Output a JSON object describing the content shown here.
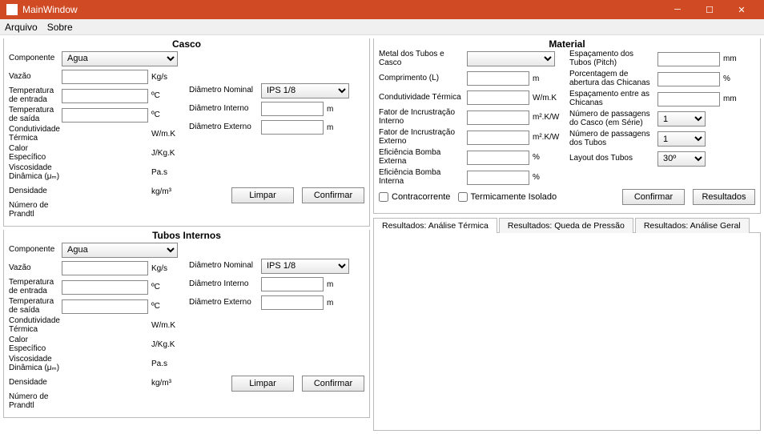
{
  "window": {
    "title": "MainWindow"
  },
  "menu": {
    "file": "Arquivo",
    "about": "Sobre"
  },
  "casco": {
    "title": "Casco",
    "componente_lbl": "Componente",
    "componente_val": "Agua",
    "vazao_lbl": "Vazão",
    "vazao_unit": "Kg/s",
    "temp_in_lbl": "Temperatura de entrada",
    "temp_unit": "ºC",
    "temp_out_lbl": "Temperatura de saída",
    "cond_lbl": "Condutividade Térmica",
    "cond_unit": "W/m.K",
    "calor_lbl": "Calor Específico",
    "calor_unit": "J/Kg.K",
    "visc_lbl": "Viscosidade Dinâmica (μₘ)",
    "visc_unit": "Pa.s",
    "dens_lbl": "Densidade",
    "dens_unit": "kg/m³",
    "prandtl_lbl": "Número de Prandtl",
    "dnom_lbl": "Diâmetro Nominal",
    "dnom_val": "IPS 1/8",
    "dint_lbl": "Diâmetro Interno",
    "dext_lbl": "Diâmetro Externo",
    "m_unit": "m",
    "limpar": "Limpar",
    "confirmar": "Confirmar"
  },
  "tubos": {
    "title": "Tubos Internos",
    "componente_val": "Agua",
    "dnom_val": "IPS 1/8"
  },
  "material": {
    "title": "Material",
    "metal_lbl": "Metal dos Tubos e Casco",
    "comp_lbl": "Comprimento (L)",
    "comp_unit": "m",
    "cond_lbl": "Condutividade Térmica",
    "cond_unit": "W/m.K",
    "finc_int_lbl": "Fator de Incrustração Interno",
    "finc_unit": "m².K/W",
    "finc_ext_lbl": "Fator de Incrustração Externo",
    "efi_ext_lbl": "Eficiência Bomba Externa",
    "pct": "%",
    "efi_int_lbl": "Eficiência Bomba Interna",
    "pitch_lbl": "Espaçamento dos Tubos (Pitch)",
    "mm": "mm",
    "abert_lbl": "Porcentagem de abertura das Chicanas",
    "chic_lbl": "Espaçamento entre as Chicanas",
    "pass_casco_lbl": "Número de passagens do Casco (em Série)",
    "pass_val": "1",
    "pass_tubos_lbl": "Número de passagens dos Tubos",
    "pass_tubos_val": "1",
    "layout_lbl": "Layout dos Tubos",
    "layout_val": "30º",
    "contra_lbl": "Contracorrente",
    "term_lbl": "Termicamente Isolado",
    "confirmar": "Confirmar",
    "resultados": "Resultados"
  },
  "tabs": {
    "t1": "Resultados: Análise Térmica",
    "t2": "Resultados: Queda de Pressão",
    "t3": "Resultados: Análise Geral"
  }
}
